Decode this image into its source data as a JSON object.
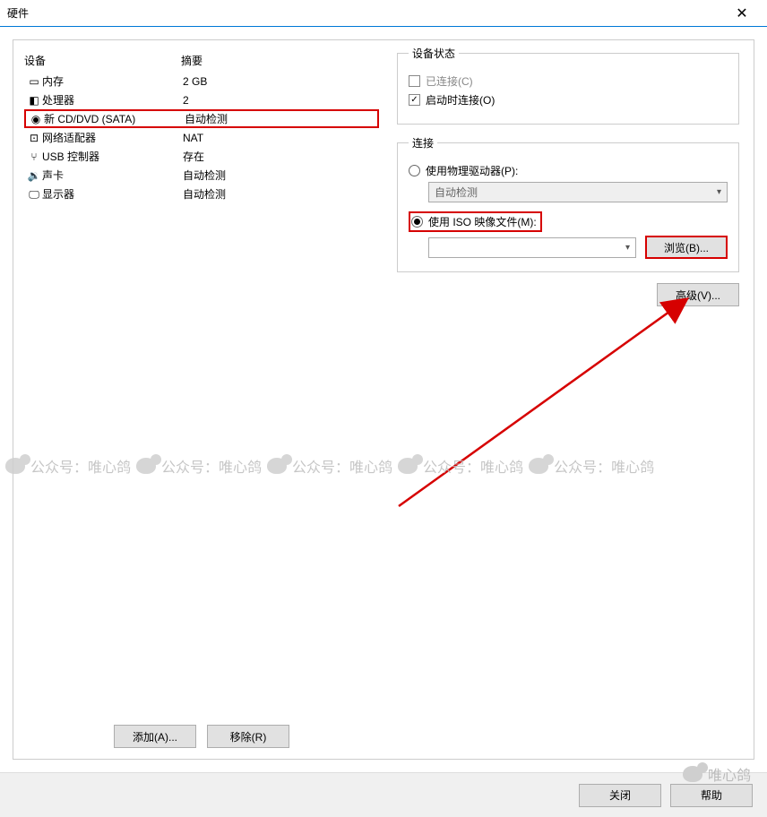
{
  "title": "硬件",
  "columns": {
    "device": "设备",
    "summary": "摘要"
  },
  "devices": [
    {
      "icon": "memory",
      "name": "内存",
      "summary": "2 GB"
    },
    {
      "icon": "cpu",
      "name": "处理器",
      "summary": "2"
    },
    {
      "icon": "disc",
      "name": "新 CD/DVD (SATA)",
      "summary": "自动检测",
      "selected": true
    },
    {
      "icon": "network",
      "name": "网络适配器",
      "summary": "NAT"
    },
    {
      "icon": "usb",
      "name": "USB 控制器",
      "summary": "存在"
    },
    {
      "icon": "sound",
      "name": "声卡",
      "summary": "自动检测"
    },
    {
      "icon": "display",
      "name": "显示器",
      "summary": "自动检测"
    }
  ],
  "buttons": {
    "add": "添加(A)...",
    "remove": "移除(R)",
    "browse": "浏览(B)...",
    "advanced": "高级(V)...",
    "close": "关闭",
    "help": "帮助"
  },
  "status_group": {
    "legend": "设备状态",
    "connected": "已连接(C)",
    "connect_on_power": "启动时连接(O)"
  },
  "connection_group": {
    "legend": "连接",
    "use_physical": "使用物理驱动器(P):",
    "auto_detect": "自动检测",
    "use_iso": "使用 ISO 映像文件(M):"
  },
  "watermark": "公众号：唯心鸽",
  "watermark_footer": "唯心鸽"
}
